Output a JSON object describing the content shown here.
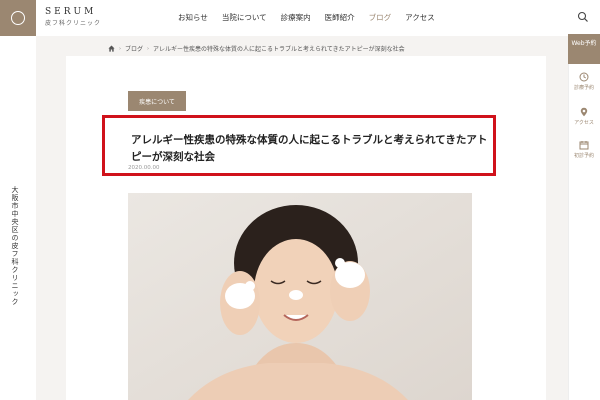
{
  "brand": {
    "name": "SERUM",
    "subtitle": "皮フ科クリニック"
  },
  "left_rail": {
    "vertical_text": "大阪市中央区の皮フ科クリニック"
  },
  "nav": {
    "items": [
      {
        "label": "お知らせ",
        "active": false
      },
      {
        "label": "当院について",
        "active": false
      },
      {
        "label": "診療案内",
        "active": false
      },
      {
        "label": "医師紹介",
        "active": false
      },
      {
        "label": "ブログ",
        "active": true
      },
      {
        "label": "アクセス",
        "active": false
      }
    ]
  },
  "breadcrumb": {
    "blog": "ブログ",
    "current": "アレルギー性疾患の特殊な体質の人に起こるトラブルと考えられてきたアトピーが深刻な社会"
  },
  "article": {
    "category": "疾患について",
    "title": "アレルギー性疾患の特殊な体質の人に起こるトラブルと考えられてきたアトピーが深刻な社会",
    "date": "2020.00.00"
  },
  "sidebar": {
    "web_reserve": "Web予約",
    "items": [
      {
        "label": "診療予約",
        "icon": "clock-icon"
      },
      {
        "label": "アクセス",
        "icon": "map-pin-icon"
      },
      {
        "label": "初診予約",
        "icon": "calendar-icon"
      }
    ]
  },
  "colors": {
    "accent": "#9b8771",
    "highlight_border": "#d0121b",
    "content_bg": "#f5f3f1"
  }
}
